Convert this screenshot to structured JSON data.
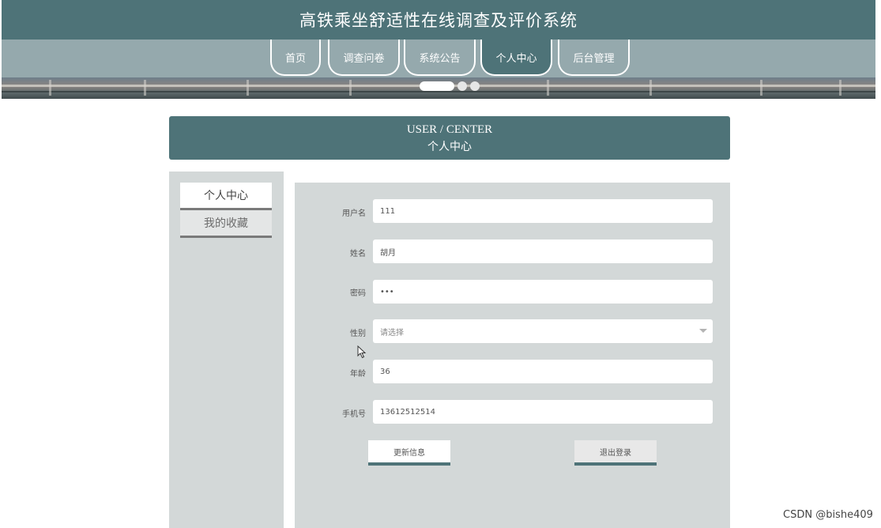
{
  "site": {
    "title": "高铁乘坐舒适性在线调查及评价系统"
  },
  "nav": {
    "items": [
      {
        "label": "首页",
        "active": false
      },
      {
        "label": "调查问卷",
        "active": false
      },
      {
        "label": "系统公告",
        "active": false
      },
      {
        "label": "个人中心",
        "active": true
      },
      {
        "label": "后台管理",
        "active": false
      }
    ]
  },
  "carousel": {
    "slide_count": 3,
    "active_slide": 1
  },
  "user_center": {
    "title_en": "USER / CENTER",
    "title_cn": "个人中心"
  },
  "sidebar": {
    "items": [
      {
        "label": "个人中心",
        "active": true
      },
      {
        "label": "我的收藏",
        "active": false
      }
    ]
  },
  "form": {
    "username": {
      "label": "用户名",
      "value": "111"
    },
    "name": {
      "label": "姓名",
      "value": "胡月"
    },
    "password": {
      "label": "密码",
      "value": "•••"
    },
    "gender": {
      "label": "性别",
      "placeholder": "请选择"
    },
    "age": {
      "label": "年龄",
      "value": "36"
    },
    "phone": {
      "label": "手机号",
      "value": "13612512514"
    }
  },
  "buttons": {
    "update": "更新信息",
    "logout": "退出登录"
  },
  "watermark": "CSDN @bishe409",
  "colors": {
    "primary": "#4e7378",
    "nav_bg": "#95a9ad",
    "panel_bg": "#d3d8d8"
  }
}
